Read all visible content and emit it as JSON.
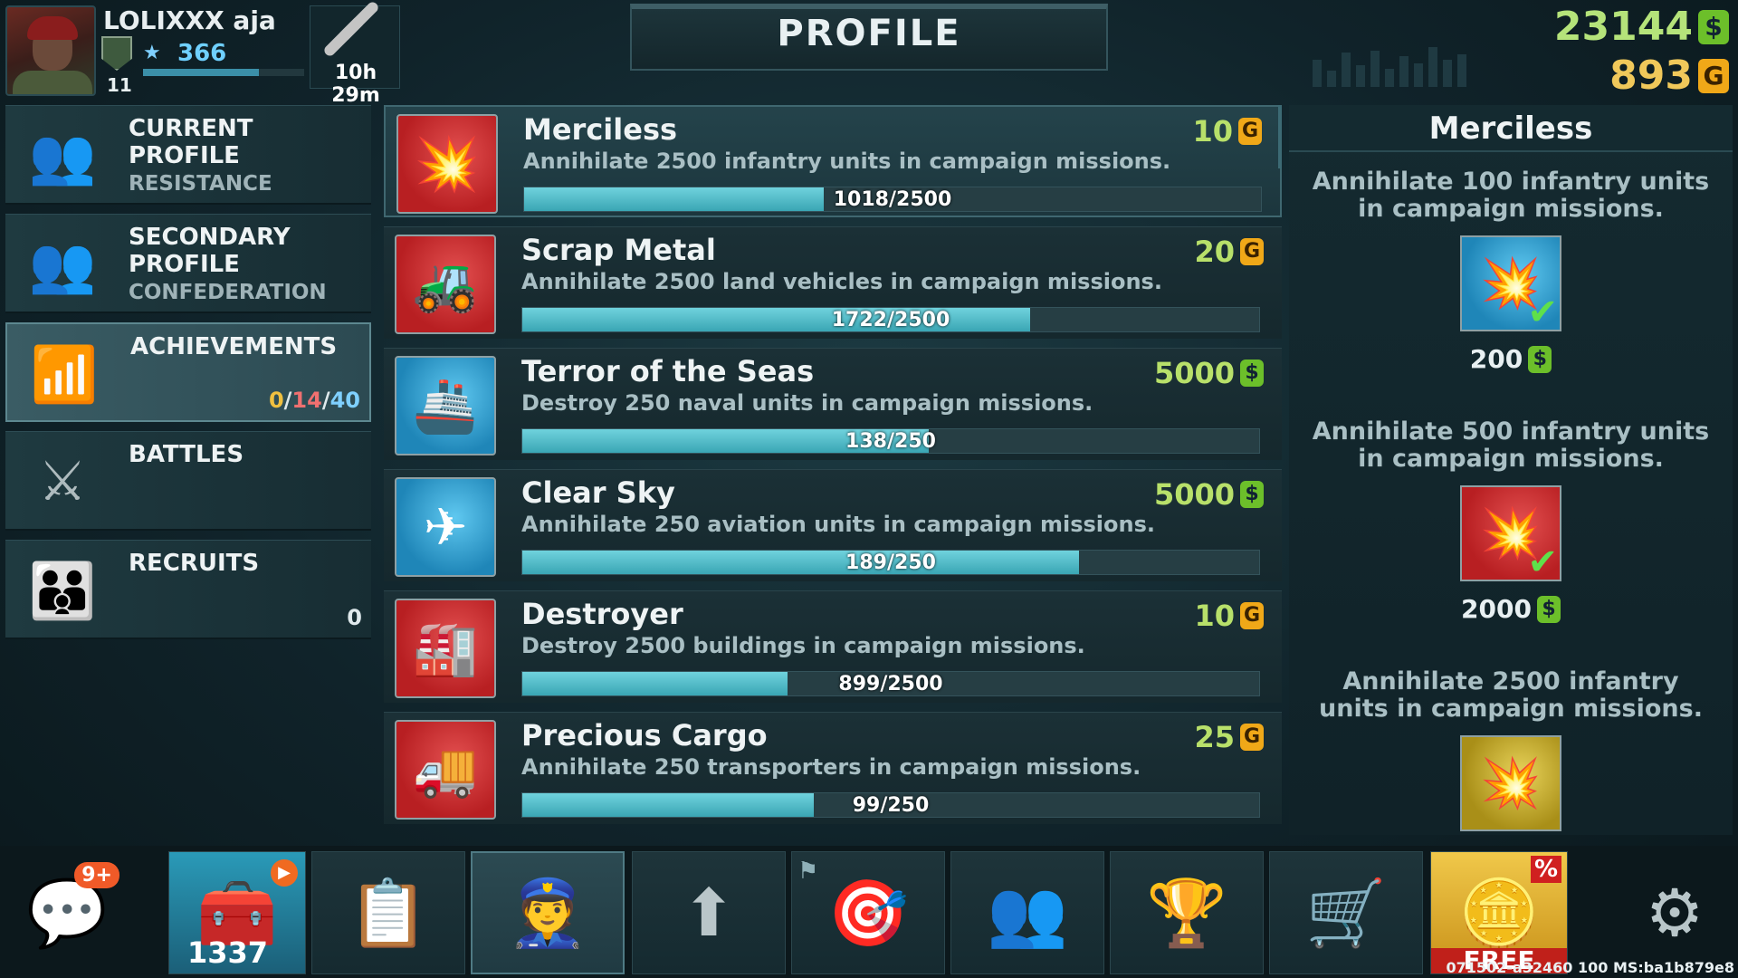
{
  "player": {
    "name": "LOLIXXX aja",
    "xp": "366",
    "level": "11",
    "timer": "10h 29m"
  },
  "header": {
    "title": "PROFILE"
  },
  "currency": {
    "dollars": "23144",
    "gold": "893",
    "dollar_symbol": "$",
    "gold_symbol": "G"
  },
  "menu": [
    {
      "label": "CURRENT PROFILE",
      "sub": "RESISTANCE",
      "icon": "soldiers-icon"
    },
    {
      "label": "SECONDARY PROFILE",
      "sub": "CONFEDERATION",
      "icon": "soldiers-icon"
    },
    {
      "label": "ACHIEVEMENTS",
      "count_a": "0",
      "sep1": "/",
      "count_b": "14",
      "sep2": "/",
      "count_c": "40",
      "icon": "rising-bars-icon"
    },
    {
      "label": "BATTLES",
      "icon": "crossed-swords-icon"
    },
    {
      "label": "RECRUITS",
      "count": "0",
      "icon": "recruits-icon"
    }
  ],
  "achievements": [
    {
      "title": "Merciless",
      "desc": "Annihilate 2500 infantry units in campaign missions.",
      "reward": "10",
      "currency": "gold",
      "progress": "1018/2500",
      "fraction": 0.407,
      "color": "red",
      "icon": "infantry-explosion-icon"
    },
    {
      "title": "Scrap Metal",
      "desc": "Annihilate 2500 land vehicles in campaign missions.",
      "reward": "20",
      "currency": "gold",
      "progress": "1722/2500",
      "fraction": 0.689,
      "color": "red",
      "icon": "tank-explosion-icon"
    },
    {
      "title": "Terror of the Seas",
      "desc": "Destroy 250 naval units in campaign missions.",
      "reward": "5000",
      "currency": "dollar",
      "progress": "138/250",
      "fraction": 0.552,
      "color": "blue",
      "icon": "sinking-ship-icon"
    },
    {
      "title": "Clear Sky",
      "desc": "Annihilate 250 aviation units in campaign missions.",
      "reward": "5000",
      "currency": "dollar",
      "progress": "189/250",
      "fraction": 0.756,
      "color": "blue",
      "icon": "jet-icon"
    },
    {
      "title": "Destroyer",
      "desc": "Destroy 2500 buildings in campaign missions.",
      "reward": "10",
      "currency": "gold",
      "progress": "899/2500",
      "fraction": 0.36,
      "color": "red",
      "icon": "factory-explosion-icon"
    },
    {
      "title": "Precious Cargo",
      "desc": "Annihilate 250 transporters in campaign missions.",
      "reward": "25",
      "currency": "gold",
      "progress": "99/250",
      "fraction": 0.396,
      "color": "red",
      "icon": "cargo-truck-icon"
    }
  ],
  "detail": {
    "title": "Merciless",
    "tiers": [
      {
        "desc": "Annihilate 100 infantry units in campaign missions.",
        "reward": "200",
        "currency": "dollar",
        "color": "blue",
        "completed": true
      },
      {
        "desc": "Annihilate 500 infantry units in campaign missions.",
        "reward": "2000",
        "currency": "dollar",
        "color": "red",
        "completed": true
      },
      {
        "desc": "Annihilate 2500 infantry units in campaign missions.",
        "color": "gold",
        "completed": false
      }
    ]
  },
  "nav": {
    "chat_badge": "9+",
    "chest_count": "1337",
    "free_label": "FREE",
    "discount": "%",
    "version": "071502-a32460 100 MS:ba1b879e8"
  }
}
